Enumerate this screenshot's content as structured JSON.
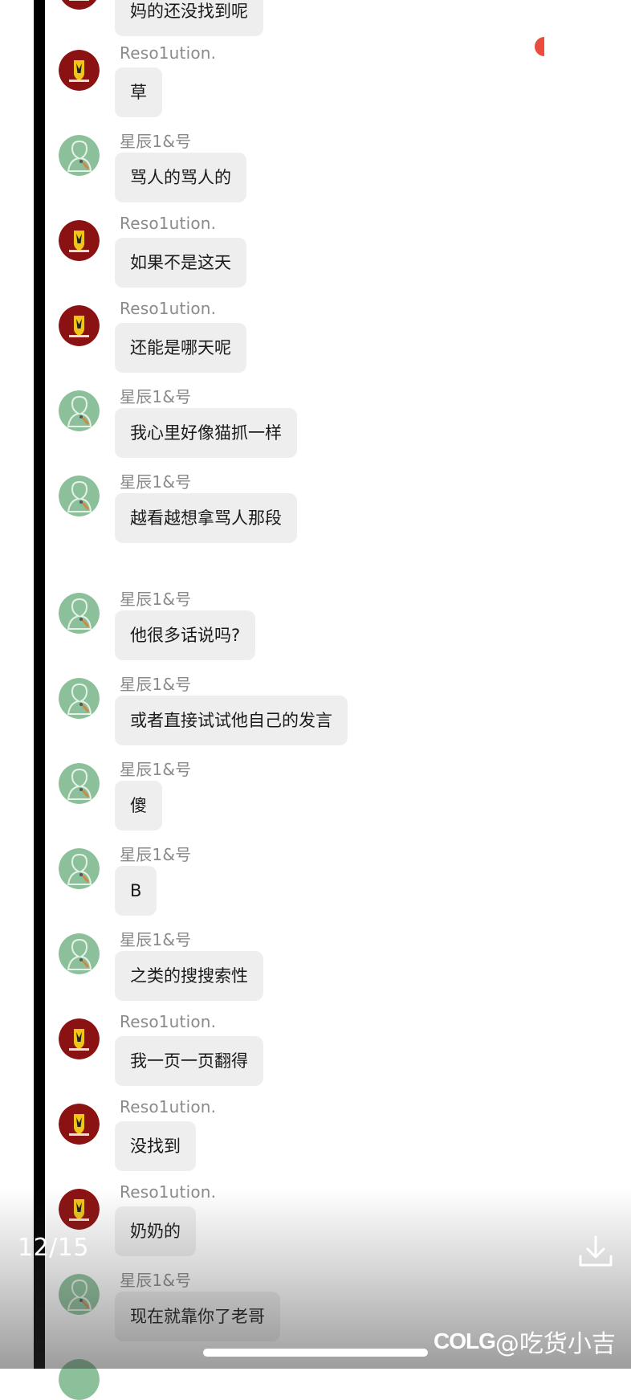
{
  "users": {
    "resolution": {
      "name": "Reso1ution.",
      "avatar_icon": "ferrari-avatar-icon",
      "avatar_color": "#8b1212"
    },
    "xingchen": {
      "name": "星辰1&号",
      "avatar_icon": "green-person-avatar-icon",
      "avatar_color": "#8cc09a"
    }
  },
  "messages": [
    {
      "sender_name": "",
      "text": "妈的还没找到呢",
      "user": "resolution"
    },
    {
      "sender_name": "Reso1ution.",
      "text": "草",
      "user": "resolution"
    },
    {
      "sender_name": "星辰1&号",
      "text": "骂人的骂人的",
      "user": "xingchen"
    },
    {
      "sender_name": "Reso1ution.",
      "text": "如果不是这天",
      "user": "resolution"
    },
    {
      "sender_name": "Reso1ution.",
      "text": "还能是哪天呢",
      "user": "resolution"
    },
    {
      "sender_name": "星辰1&号",
      "text": "我心里好像猫抓一样",
      "user": "xingchen"
    },
    {
      "sender_name": "星辰1&号",
      "text": "越看越想拿骂人那段",
      "user": "xingchen"
    },
    {
      "sender_name": "星辰1&号",
      "text": "他很多话说吗?",
      "user": "xingchen"
    },
    {
      "sender_name": "星辰1&号",
      "text": "或者直接试试他自己的发言",
      "user": "xingchen"
    },
    {
      "sender_name": "星辰1&号",
      "text": "傻",
      "user": "xingchen"
    },
    {
      "sender_name": "星辰1&号",
      "text": "B",
      "user": "xingchen"
    },
    {
      "sender_name": "星辰1&号",
      "text": "之类的搜搜索性",
      "user": "xingchen"
    },
    {
      "sender_name": "Reso1ution.",
      "text": "我一页一页翻得",
      "user": "resolution"
    },
    {
      "sender_name": "Reso1ution.",
      "text": "没找到",
      "user": "resolution"
    },
    {
      "sender_name": "Reso1ution.",
      "text": "奶奶的",
      "user": "resolution"
    },
    {
      "sender_name": "星辰1&号",
      "text": "现在就靠你了老哥",
      "user": "xingchen"
    }
  ],
  "viewer": {
    "page_counter": "12/15",
    "download_icon": "download-icon",
    "watermark_logo": "COLG",
    "watermark_text": "@吃货小吉"
  },
  "colors": {
    "bubble_bg": "#eeeeee",
    "accent_red": "#ea4d3d"
  }
}
